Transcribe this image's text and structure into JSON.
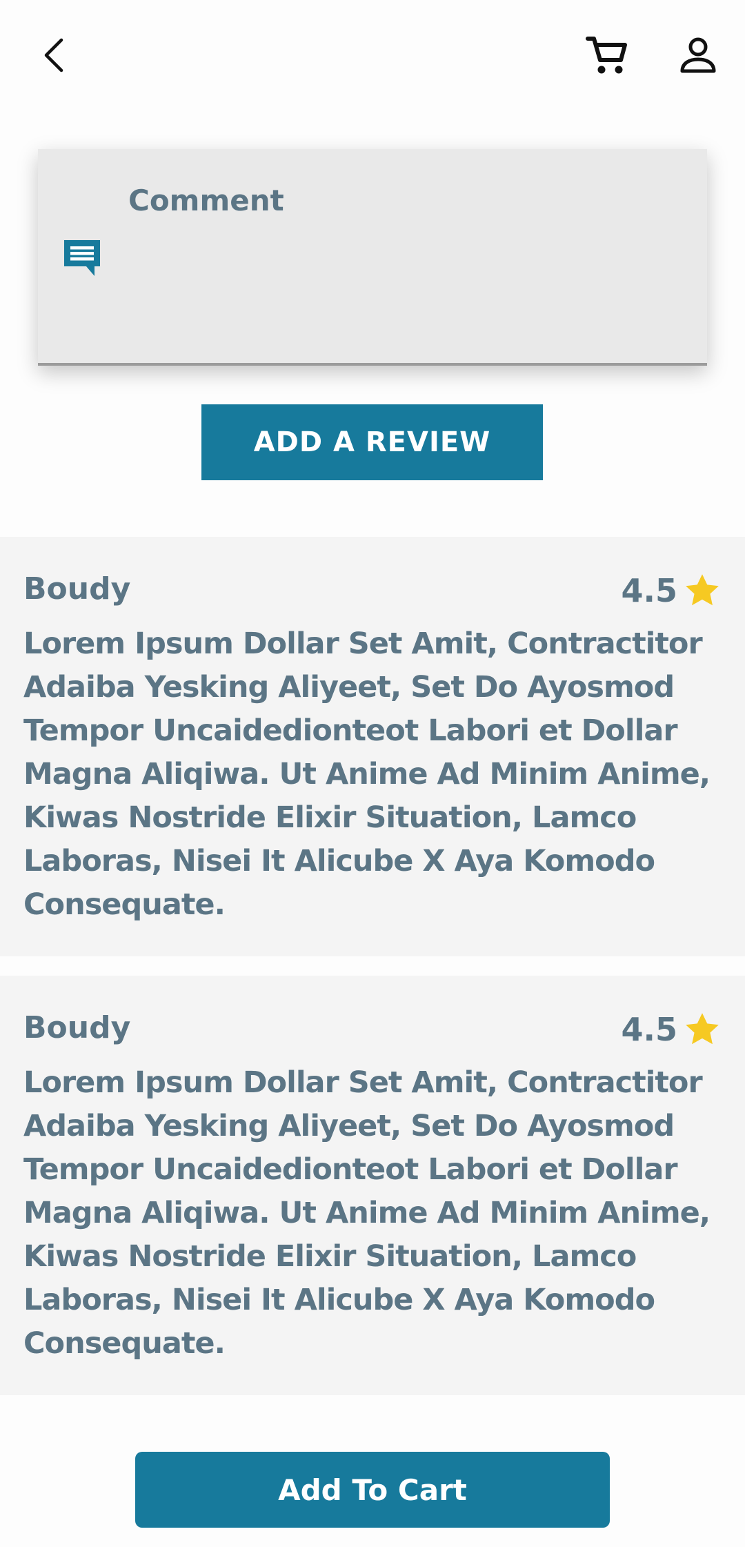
{
  "header": {
    "back_icon": "back-arrow-icon",
    "cart_icon": "cart-icon",
    "profile_icon": "person-icon"
  },
  "comment": {
    "label": "Comment",
    "icon": "comment-icon"
  },
  "buttons": {
    "add_review": "ADD A REVIEW",
    "add_to_cart": "Add To Cart"
  },
  "reviews": [
    {
      "name": "Boudy",
      "rating": "4.5",
      "text": "Lorem Ipsum Dollar Set Amit, Contractitor Adaiba Yesking Aliyeet, Set Do Ayosmod Tempor Uncaidedionteot Labori et Dollar Magna Aliqiwa. Ut Anime Ad Minim Anime, Kiwas Nostride Elixir Situation, Lamco Laboras, Nisei It Alicube X Aya Komodo Consequate."
    },
    {
      "name": "Boudy",
      "rating": "4.5",
      "text": "Lorem Ipsum Dollar Set Amit, Contractitor Adaiba Yesking Aliyeet, Set Do Ayosmod Tempor Uncaidedionteot Labori et Dollar Magna Aliqiwa. Ut Anime Ad Minim Anime, Kiwas Nostride Elixir Situation, Lamco Laboras, Nisei It Alicube X Aya Komodo Consequate."
    }
  ],
  "colors": {
    "primary": "#177a9c",
    "text": "#5b7585",
    "star": "#f6c922",
    "review_bg": "#f4f4f4"
  }
}
